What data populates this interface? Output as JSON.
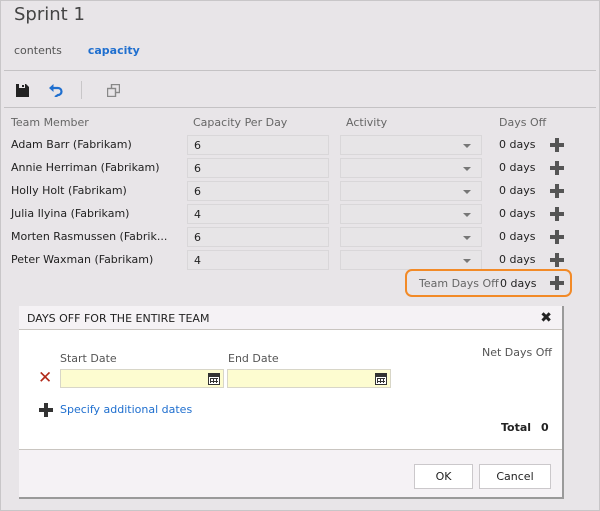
{
  "page": {
    "title": "Sprint 1"
  },
  "tabs": [
    {
      "label": "contents",
      "active": false
    },
    {
      "label": "capacity",
      "active": true
    }
  ],
  "toolbar": {
    "save_icon": "save-icon",
    "undo_icon": "undo-icon",
    "copy_icon": "copy-icon"
  },
  "table": {
    "columns": [
      "Team Member",
      "Capacity Per Day",
      "Activity",
      "Days Off"
    ],
    "rows": [
      {
        "member": "Adam Barr (Fabrikam)",
        "capacity": "6",
        "activity": "",
        "days_off": "0 days"
      },
      {
        "member": "Annie Herriman (Fabrikam)",
        "capacity": "6",
        "activity": "",
        "days_off": "0 days"
      },
      {
        "member": "Holly Holt (Fabrikam)",
        "capacity": "6",
        "activity": "",
        "days_off": "0 days"
      },
      {
        "member": "Julia Ilyina (Fabrikam)",
        "capacity": "4",
        "activity": "",
        "days_off": "0 days"
      },
      {
        "member": "Morten Rasmussen (Fabrik...",
        "capacity": "6",
        "activity": "",
        "days_off": "0 days"
      },
      {
        "member": "Peter Waxman (Fabrikam)",
        "capacity": "4",
        "activity": "",
        "days_off": "0 days"
      }
    ],
    "team_days_off": {
      "label": "Team Days Off",
      "value": "0 days"
    }
  },
  "dialog": {
    "title": "DAYS OFF FOR THE ENTIRE TEAM",
    "start_date_label": "Start Date",
    "end_date_label": "End Date",
    "net_days_off_label": "Net Days Off",
    "start_date_value": "",
    "end_date_value": "",
    "add_dates_label": "Specify additional dates",
    "total_label": "Total",
    "total_value": "0",
    "ok_label": "OK",
    "cancel_label": "Cancel"
  },
  "colors": {
    "accent": "#1f6fcf",
    "highlight": "#f28a27",
    "remove": "#b22a1a",
    "date_input_bg": "#fdfcd0"
  }
}
